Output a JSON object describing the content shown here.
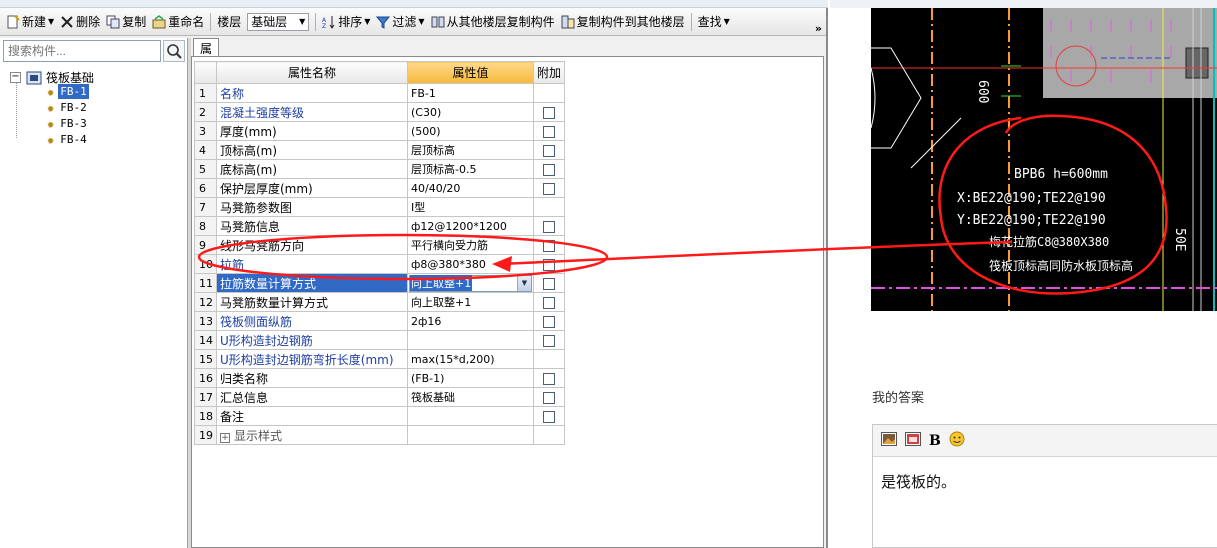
{
  "toolbar": {
    "new": "新建",
    "delete": "删除",
    "copy": "复制",
    "rename": "重命名",
    "floor_label": "楼层",
    "floor_value": "基础层",
    "sort": "排序",
    "filter": "过滤",
    "copy_from_other": "从其他楼层复制构件",
    "copy_to_other": "复制构件到其他楼层",
    "find": "查找",
    "more": "»"
  },
  "tree": {
    "search_placeholder": "搜索构件...",
    "root": "筏板基础",
    "items": [
      "FB-1",
      "FB-2",
      "FB-3",
      "FB-4"
    ]
  },
  "prop": {
    "tab": "属性编辑",
    "headers": [
      "属性名称",
      "属性值",
      "附加"
    ],
    "rows": [
      {
        "n": "1",
        "name": "名称",
        "value": "FB-1"
      },
      {
        "n": "2",
        "name": "混凝土强度等级",
        "value": "(C30)"
      },
      {
        "n": "3",
        "name": "厚度(mm)",
        "value": "(500)"
      },
      {
        "n": "4",
        "name": "顶标高(m)",
        "value": "层顶标高"
      },
      {
        "n": "5",
        "name": "底标高(m)",
        "value": "层顶标高-0.5"
      },
      {
        "n": "6",
        "name": "保护层厚度(mm)",
        "value": "40/40/20"
      },
      {
        "n": "7",
        "name": "马凳筋参数图",
        "value": "Ⅰ型"
      },
      {
        "n": "8",
        "name": "马凳筋信息",
        "value": "ф12@1200*1200"
      },
      {
        "n": "9",
        "name": "线形马凳筋方向",
        "value": "平行横向受力筋"
      },
      {
        "n": "10",
        "name": "拉筋",
        "value": "ф8@380*380"
      },
      {
        "n": "11",
        "name": "拉筋数量计算方式",
        "value": "向上取整+1"
      },
      {
        "n": "12",
        "name": "马凳筋数量计算方式",
        "value": "向上取整+1"
      },
      {
        "n": "13",
        "name": "筏板侧面纵筋",
        "value": "2ф16"
      },
      {
        "n": "14",
        "name": "U形构造封边钢筋",
        "value": ""
      },
      {
        "n": "15",
        "name": "U形构造封边钢筋弯折长度(mm)",
        "value": "max(15*d,200)"
      },
      {
        "n": "16",
        "name": "归类名称",
        "value": "(FB-1)"
      },
      {
        "n": "17",
        "name": "汇总信息",
        "value": "筏板基础"
      },
      {
        "n": "18",
        "name": "备注",
        "value": ""
      },
      {
        "n": "19",
        "name": "显示样式",
        "value": ""
      }
    ]
  },
  "cad": {
    "dim": "600",
    "line1": "BPB6 h=600mm",
    "line2": "X:BE22@190;TE22@190",
    "line3": "Y:BE22@190;TE22@190",
    "line4": "梅花拉筋C8@380X380",
    "line5": "筏板顶标高同防水板顶标高",
    "side": "50E"
  },
  "answer": {
    "label": "我的答案",
    "text": "是筏板的。"
  },
  "colors": {
    "selection": "#316ac5",
    "annotation": "#e00000",
    "header_value": "#f5b93a"
  }
}
